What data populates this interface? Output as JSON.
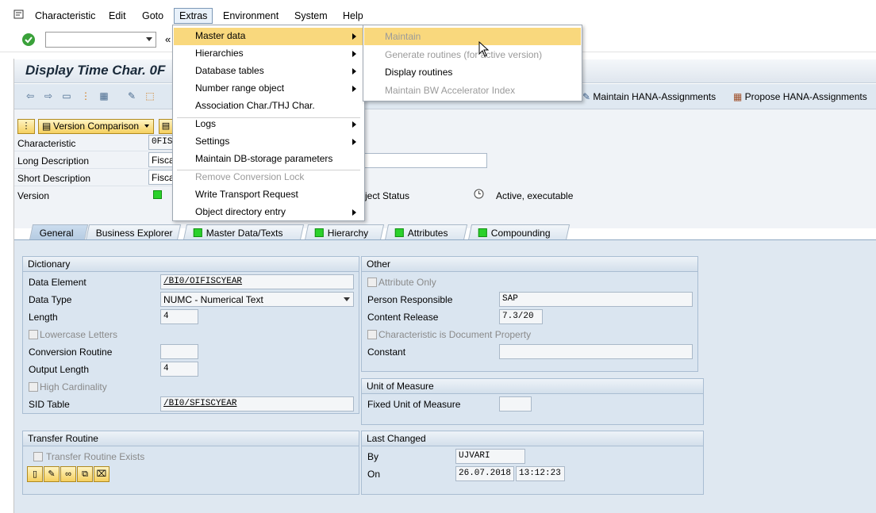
{
  "menubar": {
    "items": [
      "Characteristic",
      "Edit",
      "Goto",
      "Extras",
      "Environment",
      "System",
      "Help"
    ]
  },
  "window": {
    "title": "Display Time Char. 0F"
  },
  "toolbar": {
    "hana_maintain": "Maintain HANA-Assignments",
    "hana_propose": "Propose HANA-Assignments",
    "version_comparison": "Version Comparison"
  },
  "header": {
    "characteristic_label": "Characteristic",
    "characteristic_value": "0FIS",
    "long_desc_label": "Long Description",
    "long_desc_value": "Fisca",
    "short_desc_label": "Short Description",
    "short_desc_value": "Fisca",
    "version_label": "Version",
    "object_status_label": "ject Status",
    "object_status_value": "Active, executable"
  },
  "tabs": [
    "General",
    "Business Explorer",
    "Master Data/Texts",
    "Hierarchy",
    "Attributes",
    "Compounding"
  ],
  "dictionary": {
    "title": "Dictionary",
    "data_element_label": "Data Element",
    "data_element_value": "/BI0/OIFISCYEAR",
    "data_type_label": "Data Type",
    "data_type_value": "NUMC - Numerical Text",
    "length_label": "Length",
    "length_value": "4",
    "lowercase_label": "Lowercase Letters",
    "conversion_label": "Conversion Routine",
    "conversion_value": "",
    "output_length_label": "Output Length",
    "output_length_value": "4",
    "high_card_label": "High Cardinality",
    "sid_table_label": "SID Table",
    "sid_table_value": "/BI0/SFISCYEAR"
  },
  "other": {
    "title": "Other",
    "attribute_only_label": "Attribute Only",
    "person_label": "Person Responsible",
    "person_value": "SAP",
    "content_release_label": "Content Release",
    "content_release_value": "7.3/20",
    "doc_property_label": "Characteristic is Document Property",
    "constant_label": "Constant",
    "constant_value": ""
  },
  "uom": {
    "title": "Unit of Measure",
    "fixed_label": "Fixed Unit of Measure",
    "fixed_value": ""
  },
  "transfer": {
    "title": "Transfer Routine",
    "exists_label": "Transfer Routine Exists"
  },
  "last_changed": {
    "title": "Last Changed",
    "by_label": "By",
    "by_value": "UJVARI",
    "on_label": "On",
    "date_value": "26.07.2018",
    "time_value": "13:12:23"
  },
  "extras_menu": {
    "master_data": "Master data",
    "hierarchies": "Hierarchies",
    "database_tables": "Database tables",
    "number_range": "Number range object",
    "association": "Association Char./THJ Char.",
    "logs": "Logs",
    "settings": "Settings",
    "maintain_db": "Maintain DB-storage parameters",
    "remove_lock": "Remove Conversion Lock",
    "write_transport": "Write Transport Request",
    "object_directory": "Object directory entry"
  },
  "submenu": {
    "maintain": "Maintain",
    "generate": "Generate routines (for active version)",
    "display_routines": "Display routines",
    "maintain_bw": "Maintain BW Accelerator Index"
  },
  "colors": {
    "menu_highlight": "#f9d87d",
    "tab_area": "#dfe8f1",
    "status_green": "#2bd12b"
  }
}
